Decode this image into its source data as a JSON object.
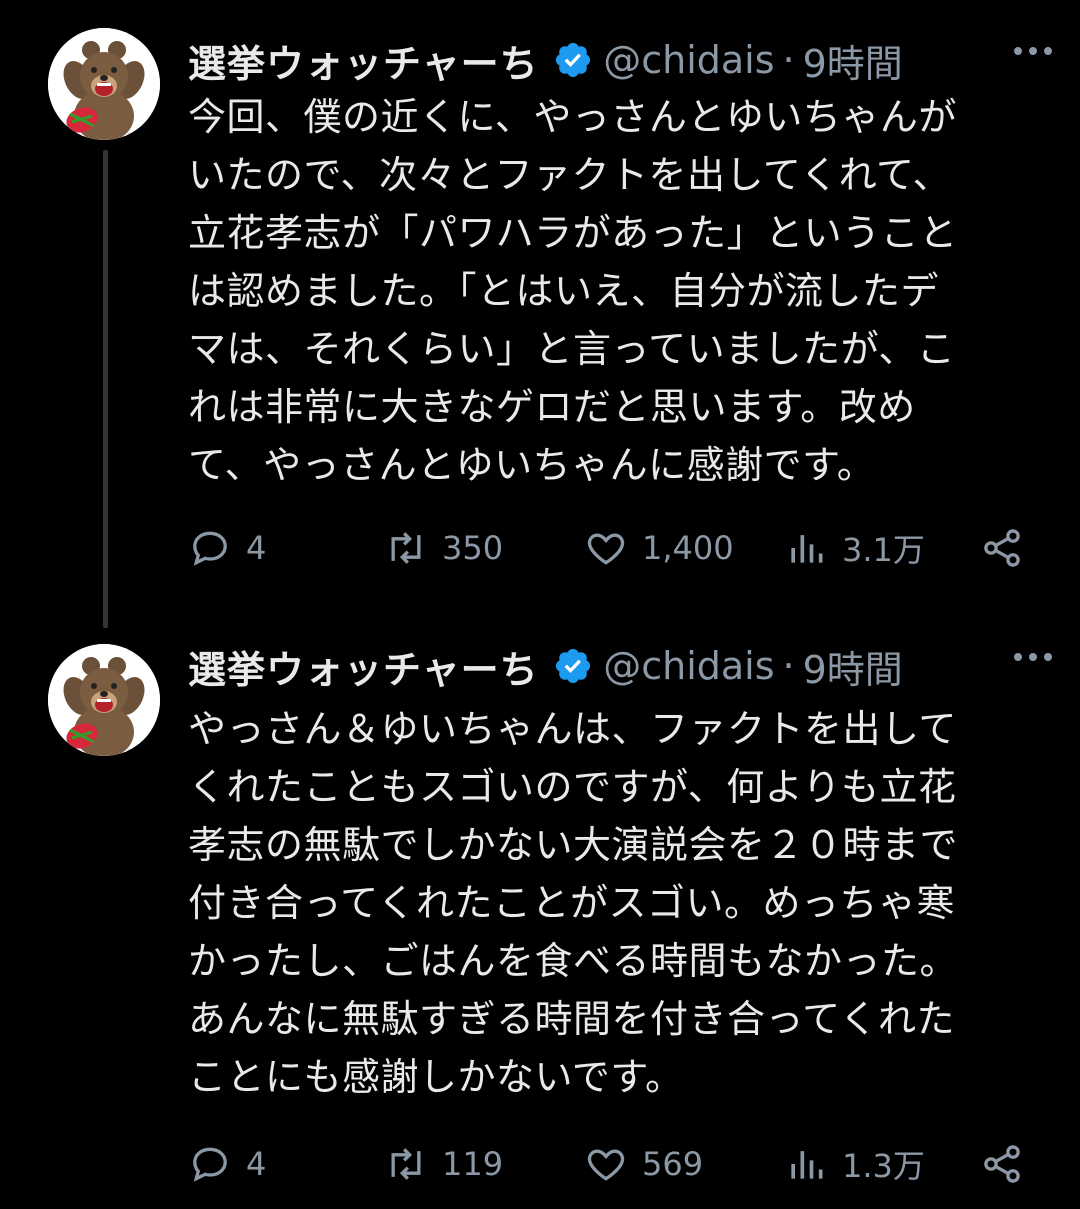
{
  "tweets": [
    {
      "display_name": "選挙ウォッチャーち ",
      "handle": "@chidais",
      "separator": "·",
      "time": "9時間",
      "text": "今回、僕の近くに、やっさんとゆいちゃんが\nいたので、次々とファクトを出してくれて、\n立花孝志が「パワハラがあった」ということ\nは認めました。「とはいえ、自分が流したデ\nマは、それくらい」と言っていましたが、こ\nれは非常に大きなゲロだと思います。改め\nて、やっさんとゆいちゃんに感謝です。",
      "replies": "4",
      "retweets": "350",
      "likes": "1,400",
      "views": "3.1万"
    },
    {
      "display_name": "選挙ウォッチャーち ",
      "handle": "@chidais",
      "separator": "·",
      "time": "9時間",
      "text": "やっさん＆ゆいちゃんは、ファクトを出して\nくれたこともスゴいのですが、何よりも立花\n孝志の無駄でしかない大演説会を２０時まで\n付き合ってくれたことがスゴい。めっちゃ寒\nかったし、ごはんを食べる時間もなかった。\nあんなに無駄すぎる時間を付き合ってくれた\nことにも感謝しかないです。",
      "replies": "4",
      "retweets": "119",
      "likes": "569",
      "views": "1.3万"
    }
  ],
  "icons": {
    "verified": "verified-badge-icon",
    "more": "more-options-icon",
    "reply": "reply-icon",
    "retweet": "retweet-icon",
    "like": "heart-icon",
    "views": "views-icon",
    "share": "share-icon"
  },
  "colors": {
    "background": "#000000",
    "text": "#e7e9ea",
    "muted": "#8b98a5",
    "verified": "#1d9bf0",
    "thread_line": "#333639"
  }
}
